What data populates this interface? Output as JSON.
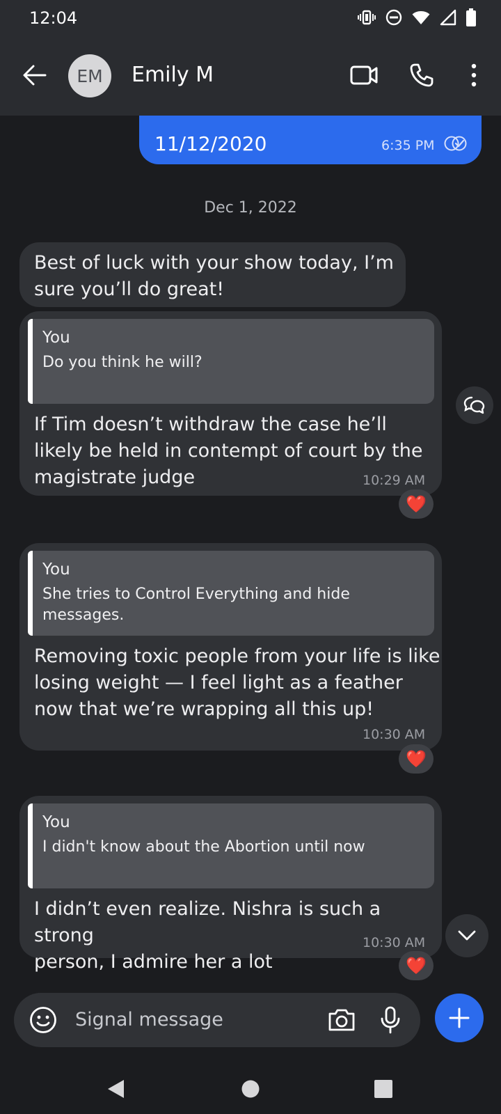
{
  "status_bar": {
    "time": "12:04",
    "icons": [
      "vibrate-icon",
      "do-not-disturb-icon",
      "wifi-icon",
      "signal-icon",
      "battery-icon"
    ]
  },
  "header": {
    "avatar_initials": "EM",
    "contact_name": "Emily M",
    "actions": [
      "back-arrow-icon",
      "video-call-icon",
      "phone-icon",
      "more-vert-icon"
    ]
  },
  "conversation": {
    "outgoing_top": {
      "text": "11/12/2020",
      "time": "6:35 PM",
      "status": "delivered"
    },
    "date_divider": "Dec 1, 2022",
    "messages": [
      {
        "text": "Best of luck with your show today, I’m\nsure you’ll do great!"
      },
      {
        "quote_author": "You",
        "quote_text": "Do you think he will?",
        "text": "If Tim doesn’t withdraw the case he’ll\nlikely be held in contempt of court by the\nmagistrate judge",
        "time": "10:29 AM",
        "reaction": "❤️"
      },
      {
        "quote_author": "You",
        "quote_text": "She tries to Control Everything and hide\nmessages.",
        "text": "Removing toxic people from your life is like\nlosing weight — I feel light as a feather\nnow that we’re wrapping all this up!",
        "time": "10:30 AM",
        "reaction": "❤️"
      },
      {
        "quote_author": "You",
        "quote_text": "I didn't know about the Abortion until now",
        "text": "I didn’t even realize. Nishra is such a strong\nperson, I admire her a lot",
        "time": "10:30 AM",
        "reaction": "❤️"
      }
    ]
  },
  "composer": {
    "placeholder": "Signal message"
  },
  "colors": {
    "accent": "#2c6bed",
    "background": "#1b1c1f",
    "bar_background": "#2a2c30",
    "incoming_bubble": "#303236",
    "quote_background": "#505257",
    "reaction_heart": "#ee2b3b"
  }
}
